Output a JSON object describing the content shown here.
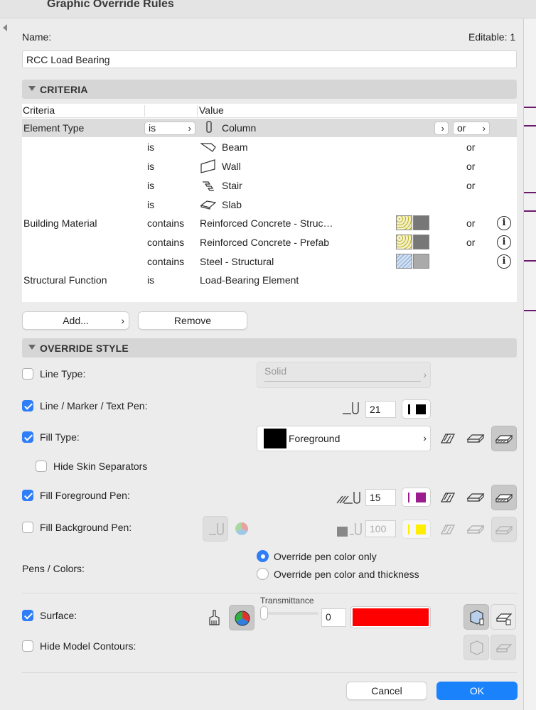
{
  "window": {
    "title": "Graphic Override Rules"
  },
  "name_field": {
    "label": "Name:",
    "value": "RCC Load Bearing",
    "editable_label": "Editable: 1"
  },
  "criteria": {
    "section_title": "CRITERIA",
    "columns": [
      "Criteria",
      "Value"
    ],
    "rows": [
      {
        "criteria": "Element Type",
        "op": "is",
        "icon": "column-icon",
        "value": "Column",
        "conj": "or"
      },
      {
        "criteria": "",
        "op": "is",
        "icon": "beam-icon",
        "value": "Beam",
        "conj": "or"
      },
      {
        "criteria": "",
        "op": "is",
        "icon": "wall-icon",
        "value": "Wall",
        "conj": "or"
      },
      {
        "criteria": "",
        "op": "is",
        "icon": "stair-icon",
        "value": "Stair",
        "conj": "or"
      },
      {
        "criteria": "",
        "op": "is",
        "icon": "slab-icon",
        "value": "Slab",
        "conj": ""
      },
      {
        "criteria": "Building Material",
        "op": "contains",
        "value": "Reinforced Concrete - Struc…",
        "conj": "or"
      },
      {
        "criteria": "",
        "op": "contains",
        "value": "Reinforced Concrete - Prefab",
        "conj": "or"
      },
      {
        "criteria": "",
        "op": "contains",
        "value": "Steel - Structural",
        "conj": ""
      },
      {
        "criteria": "Structural Function",
        "op": "is",
        "value": "Load-Bearing Element",
        "conj": ""
      }
    ],
    "add_label": "Add...",
    "remove_label": "Remove"
  },
  "override": {
    "section_title": "OVERRIDE STYLE",
    "line_type": {
      "label": "Line Type:",
      "checked": false,
      "value": "Solid"
    },
    "line_pen": {
      "label": "Line / Marker / Text Pen:",
      "checked": true,
      "pen": "21"
    },
    "fill_type": {
      "label": "Fill Type:",
      "checked": true,
      "value": "Foreground"
    },
    "hide_skin": {
      "label": "Hide Skin Separators",
      "checked": false
    },
    "fill_fg": {
      "label": "Fill Foreground Pen:",
      "checked": true,
      "pen": "15",
      "color": "#9b1c8e"
    },
    "fill_bg": {
      "label": "Fill Background Pen:",
      "checked": false,
      "pen": "100",
      "color": "#ffee00"
    },
    "pens_colors": {
      "label": "Pens / Colors:",
      "option1": "Override pen color only",
      "option2": "Override pen color and thickness",
      "selected": 1
    },
    "surface": {
      "label": "Surface:",
      "checked": true,
      "transmittance_label": "Transmittance",
      "transmittance": "0",
      "color": "#ff0000"
    },
    "hide_contours": {
      "label": "Hide Model Contours:",
      "checked": false
    }
  },
  "footer": {
    "cancel_label": "Cancel",
    "ok_label": "OK",
    "ok_color": "#1a82fb"
  }
}
